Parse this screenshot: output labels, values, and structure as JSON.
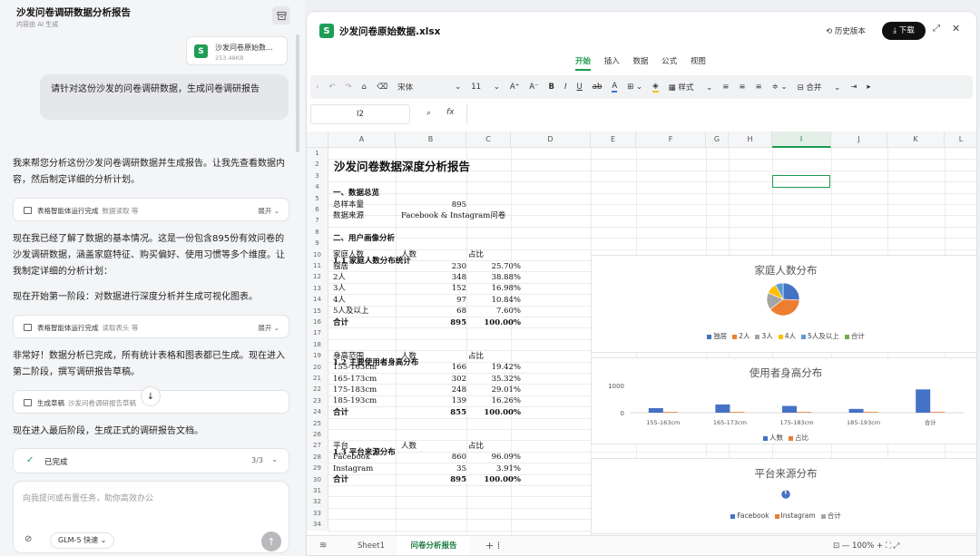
{
  "chat": {
    "title": "沙发问卷调研数据分析报告",
    "subtitle": "内容由 AI 生成",
    "file": {
      "name": "沙发问卷原始数...",
      "size": "253.48KB",
      "icon": "S"
    },
    "user_message": "请针对这份沙发的问卷调研数据，生成问卷调研报告",
    "para1": "我来帮您分析这份沙发问卷调研数据并生成报告。让我先查看数据内容，然后制定详细的分析计划。",
    "tool1": {
      "label": "表格智能体运行完成",
      "detail": "数据读取 等",
      "expand": "展开"
    },
    "para2": "现在我已经了解了数据的基本情况。这是一份包含895份有效问卷的沙发调研数据，涵盖家庭特征、购买偏好、使用习惯等多个维度。让我制定详细的分析计划：",
    "para3": "现在开始第一阶段：对数据进行深度分析并生成可视化图表。",
    "tool2": {
      "label": "表格智能体运行完成",
      "detail": "读取表头 等",
      "expand": "展开"
    },
    "para4": "非常好！数据分析已完成，所有统计表格和图表都已生成。现在进入第二阶段，撰写调研报告草稿。",
    "tool3": {
      "label": "生成草稿",
      "detail": "沙发问卷调研报告草稿"
    },
    "para5": "现在进入最后阶段，生成正式的调研报告文档。",
    "done_label": "已完成",
    "done_count": "3/3",
    "input_placeholder": "向我提问或布置任务，助你高效办公",
    "model": "GLM-5 快速"
  },
  "sheet": {
    "title": "沙发问卷原始数据.xlsx",
    "history": "历史版本",
    "download": "下载",
    "menus": [
      "开始",
      "插入",
      "数据",
      "公式",
      "视图"
    ],
    "toolbar": {
      "font": "宋体",
      "size": "11",
      "style": "样式",
      "merge": "合并"
    },
    "cell_ref": "I2",
    "columns": [
      "A",
      "B",
      "C",
      "D",
      "E",
      "F",
      "G",
      "H",
      "I",
      "J",
      "K",
      "L"
    ],
    "rows": [
      "1",
      "2",
      "3",
      "4",
      "5",
      "6",
      "7",
      "8",
      "9",
      "10",
      "11",
      "12",
      "13",
      "14",
      "15",
      "16",
      "17",
      "18",
      "19",
      "20",
      "21",
      "22",
      "23",
      "24",
      "25",
      "26",
      "27",
      "28",
      "29",
      "30",
      "31",
      "32",
      "33",
      "34"
    ],
    "cells": {
      "r1": "沙发问卷数据深度分析报告",
      "r3": "一、数据总览",
      "r4a": "总样本量",
      "r4b": "895",
      "r5a": "数据来源",
      "r5b": "Facebook & Instagram问卷",
      "r7": "二、用户画像分析",
      "r9": "1.1 家庭人数分布统计",
      "r10": [
        "家庭人数",
        "人数",
        "占比"
      ],
      "r11": [
        "独居",
        "230",
        "25.70%"
      ],
      "r12": [
        "2人",
        "348",
        "38.88%"
      ],
      "r13": [
        "3人",
        "152",
        "16.98%"
      ],
      "r14": [
        "4人",
        "97",
        "10.84%"
      ],
      "r15": [
        "5人及以上",
        "68",
        "7.60%"
      ],
      "r16": [
        "合计",
        "895",
        "100.00%"
      ],
      "r18": "1.2 主要使用者身高分布",
      "r19": [
        "身高范围",
        "人数",
        "占比"
      ],
      "r20": [
        "155-163cm",
        "166",
        "19.42%"
      ],
      "r21": [
        "165-173cm",
        "302",
        "35.32%"
      ],
      "r22": [
        "175-183cm",
        "248",
        "29.01%"
      ],
      "r23": [
        "185-193cm",
        "139",
        "16.26%"
      ],
      "r24": [
        "合计",
        "855",
        "100.00%"
      ],
      "r26": "1.3 平台来源分布",
      "r27": [
        "平台",
        "人数",
        "占比"
      ],
      "r28": [
        "Facebook",
        "860",
        "96.09%"
      ],
      "r29": [
        "Instagram",
        "35",
        "3.91%"
      ],
      "r30": [
        "合计",
        "895",
        "100.00%"
      ]
    },
    "tabs": [
      "Sheet1",
      "问卷分析报告"
    ],
    "zoom": "100%"
  },
  "colors": {
    "blue": "#4472c4",
    "orange": "#ed7d31",
    "gray": "#a5a5a5",
    "yellow": "#ffc000",
    "lightblue": "#5b9bd5",
    "green": "#70ad47",
    "darkblue": "#264478",
    "accent": "#1a9a4f"
  },
  "chart_data": [
    {
      "type": "pie",
      "title": "家庭人数分布",
      "categories": [
        "独居",
        "2人",
        "3人",
        "4人",
        "5人及以上"
      ],
      "values": [
        230,
        348,
        152,
        97,
        68
      ],
      "legend": [
        "独居",
        "2人",
        "3人",
        "4人",
        "5人及以上",
        "合计"
      ]
    },
    {
      "type": "bar",
      "title": "使用者身高分布",
      "categories": [
        "155-163cm",
        "165-173cm",
        "175-183cm",
        "185-193cm",
        "合计"
      ],
      "series": [
        {
          "name": "人数",
          "values": [
            166,
            302,
            248,
            139,
            855
          ]
        },
        {
          "name": "占比",
          "values": [
            0.1942,
            0.3532,
            0.2901,
            0.1626,
            1.0
          ]
        }
      ],
      "yticks": [
        "1000",
        "0"
      ],
      "ylim": [
        0,
        1000
      ]
    },
    {
      "type": "pie",
      "title": "平台来源分布",
      "categories": [
        "Facebook",
        "Instagram"
      ],
      "values": [
        860,
        35
      ],
      "legend": [
        "Facebook",
        "Instagram",
        "合计"
      ]
    }
  ]
}
